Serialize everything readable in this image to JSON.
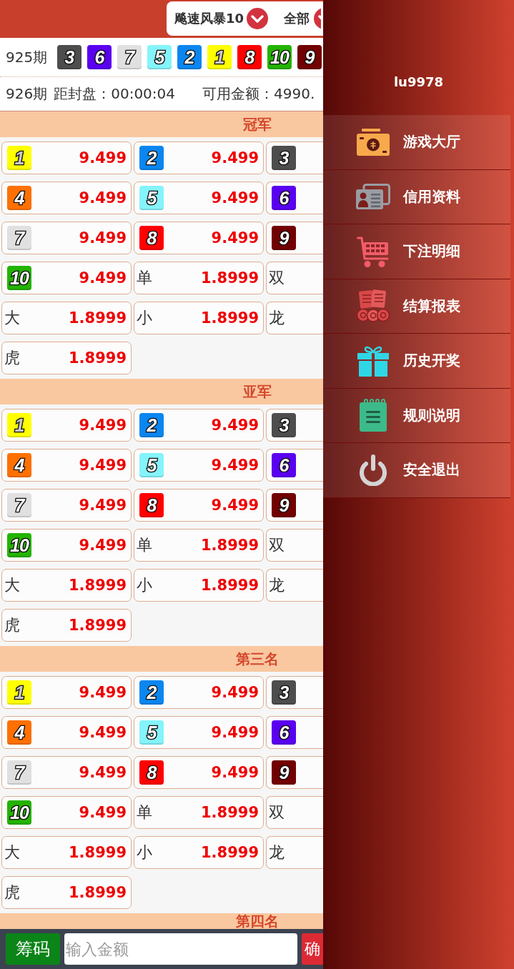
{
  "header": {
    "lottery": "飚速风暴10",
    "filter": "全部"
  },
  "last_draw": {
    "period": "925期",
    "numbers": [
      {
        "value": "3",
        "color": "#4d4d4d"
      },
      {
        "value": "6",
        "color": "#5a00f0"
      },
      {
        "value": "7",
        "color": "#e0e0e0"
      },
      {
        "value": "5",
        "color": "#84f4fa"
      },
      {
        "value": "2",
        "color": "#0a86f0"
      },
      {
        "value": "1",
        "color": "#ffff00"
      },
      {
        "value": "8",
        "color": "#ff0000"
      },
      {
        "value": "10",
        "color": "#24b300"
      },
      {
        "value": "9",
        "color": "#720000"
      }
    ]
  },
  "current": {
    "period": "926期",
    "countdown": "距封盘：00:00:04",
    "balance": "可用金额：4990."
  },
  "sections": [
    {
      "title": "冠军",
      "cells": [
        {
          "kind": "ball",
          "number": "1",
          "color": "#ffff00",
          "odds": "9.499"
        },
        {
          "kind": "ball",
          "number": "2",
          "color": "#0a86f0",
          "odds": "9.499"
        },
        {
          "kind": "ball",
          "number": "3",
          "color": "#4d4d4d"
        },
        {
          "kind": "ball",
          "number": "4",
          "color": "#ff7000",
          "odds": "9.499"
        },
        {
          "kind": "ball",
          "number": "5",
          "color": "#84f4fa",
          "odds": "9.499"
        },
        {
          "kind": "ball",
          "number": "6",
          "color": "#5a00f0"
        },
        {
          "kind": "ball",
          "number": "7",
          "color": "#e0e0e0",
          "odds": "9.499"
        },
        {
          "kind": "ball",
          "number": "8",
          "color": "#ff0000",
          "odds": "9.499"
        },
        {
          "kind": "ball",
          "number": "9",
          "color": "#720000"
        },
        {
          "kind": "ball",
          "number": "10",
          "color": "#24b300",
          "odds": "9.499"
        },
        {
          "kind": "text",
          "label": "单",
          "odds": "1.8999"
        },
        {
          "kind": "text",
          "label": "双"
        },
        {
          "kind": "text",
          "label": "大",
          "odds": "1.8999"
        },
        {
          "kind": "text",
          "label": "小",
          "odds": "1.8999"
        },
        {
          "kind": "text",
          "label": "龙"
        },
        {
          "kind": "text",
          "label": "虎",
          "odds": "1.8999"
        }
      ]
    },
    {
      "title": "亚军",
      "cells": [
        {
          "kind": "ball",
          "number": "1",
          "color": "#ffff00",
          "odds": "9.499"
        },
        {
          "kind": "ball",
          "number": "2",
          "color": "#0a86f0",
          "odds": "9.499"
        },
        {
          "kind": "ball",
          "number": "3",
          "color": "#4d4d4d"
        },
        {
          "kind": "ball",
          "number": "4",
          "color": "#ff7000",
          "odds": "9.499"
        },
        {
          "kind": "ball",
          "number": "5",
          "color": "#84f4fa",
          "odds": "9.499"
        },
        {
          "kind": "ball",
          "number": "6",
          "color": "#5a00f0"
        },
        {
          "kind": "ball",
          "number": "7",
          "color": "#e0e0e0",
          "odds": "9.499"
        },
        {
          "kind": "ball",
          "number": "8",
          "color": "#ff0000",
          "odds": "9.499"
        },
        {
          "kind": "ball",
          "number": "9",
          "color": "#720000"
        },
        {
          "kind": "ball",
          "number": "10",
          "color": "#24b300",
          "odds": "9.499"
        },
        {
          "kind": "text",
          "label": "单",
          "odds": "1.8999"
        },
        {
          "kind": "text",
          "label": "双"
        },
        {
          "kind": "text",
          "label": "大",
          "odds": "1.8999"
        },
        {
          "kind": "text",
          "label": "小",
          "odds": "1.8999"
        },
        {
          "kind": "text",
          "label": "龙"
        },
        {
          "kind": "text",
          "label": "虎",
          "odds": "1.8999"
        }
      ]
    },
    {
      "title": "第三名",
      "cells": [
        {
          "kind": "ball",
          "number": "1",
          "color": "#ffff00",
          "odds": "9.499"
        },
        {
          "kind": "ball",
          "number": "2",
          "color": "#0a86f0",
          "odds": "9.499"
        },
        {
          "kind": "ball",
          "number": "3",
          "color": "#4d4d4d"
        },
        {
          "kind": "ball",
          "number": "4",
          "color": "#ff7000",
          "odds": "9.499"
        },
        {
          "kind": "ball",
          "number": "5",
          "color": "#84f4fa",
          "odds": "9.499"
        },
        {
          "kind": "ball",
          "number": "6",
          "color": "#5a00f0"
        },
        {
          "kind": "ball",
          "number": "7",
          "color": "#e0e0e0",
          "odds": "9.499"
        },
        {
          "kind": "ball",
          "number": "8",
          "color": "#ff0000",
          "odds": "9.499"
        },
        {
          "kind": "ball",
          "number": "9",
          "color": "#720000"
        },
        {
          "kind": "ball",
          "number": "10",
          "color": "#24b300",
          "odds": "9.499"
        },
        {
          "kind": "text",
          "label": "单",
          "odds": "1.8999"
        },
        {
          "kind": "text",
          "label": "双"
        },
        {
          "kind": "text",
          "label": "大",
          "odds": "1.8999"
        },
        {
          "kind": "text",
          "label": "小",
          "odds": "1.8999"
        },
        {
          "kind": "text",
          "label": "龙"
        },
        {
          "kind": "text",
          "label": "虎",
          "odds": "1.8999"
        }
      ]
    },
    {
      "title": "第四名"
    }
  ],
  "bottom_bar": {
    "chips_button": "筹码",
    "amount_field": {
      "placeholder": "输入金额"
    },
    "confirm_button": "确"
  },
  "side_menu": {
    "username": "lu9978",
    "items": [
      {
        "label": "游戏大厅"
      },
      {
        "label": "信用资料"
      },
      {
        "label": "下注明细"
      },
      {
        "label": "结算报表"
      },
      {
        "label": "历史开奖"
      },
      {
        "label": "规则说明"
      },
      {
        "label": "安全退出"
      }
    ]
  }
}
